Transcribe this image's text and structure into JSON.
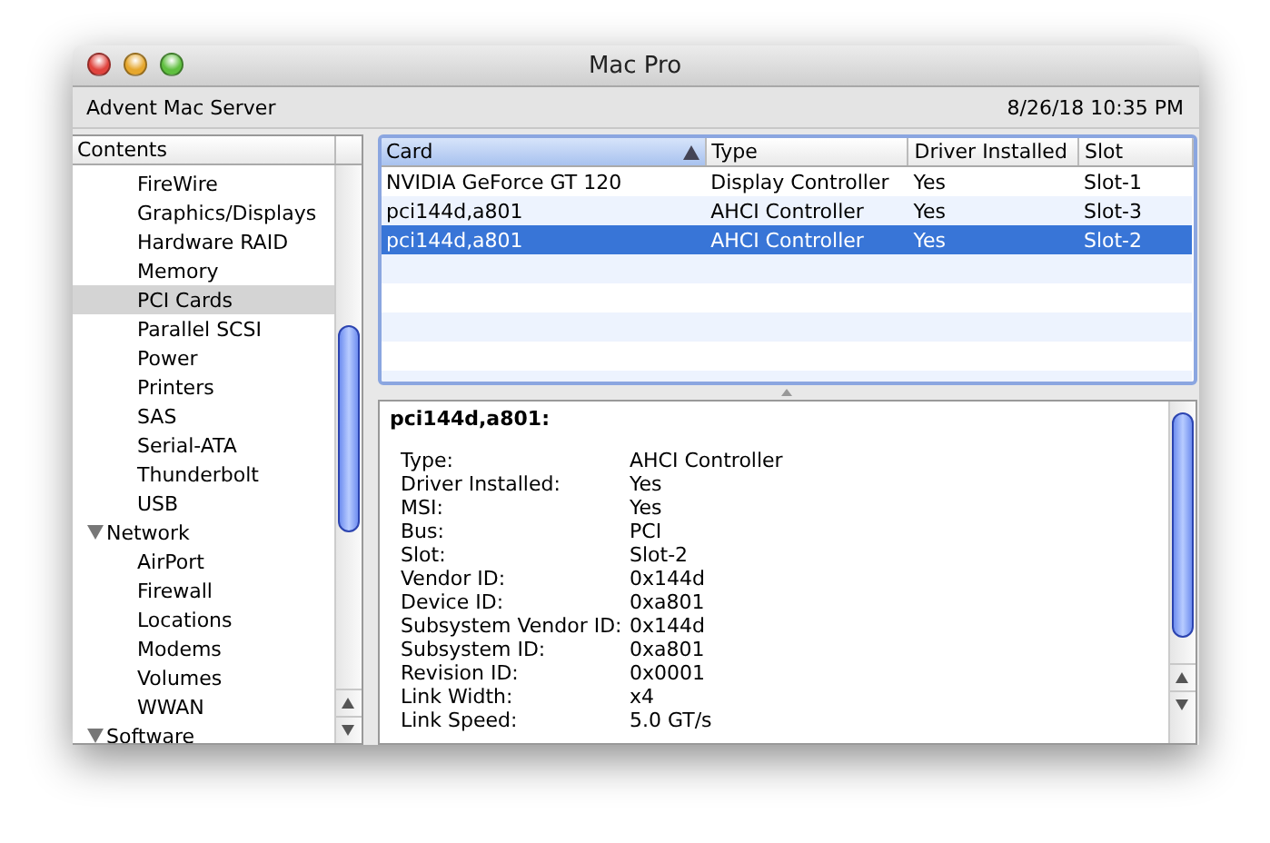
{
  "window": {
    "title": "Mac Pro"
  },
  "toolbar": {
    "computer_name": "Advent Mac Server",
    "date_time": "8/26/18 10:35 PM"
  },
  "sidebar": {
    "header": "Contents",
    "items": [
      {
        "kind": "leaf",
        "label": "FireWire",
        "selected": false
      },
      {
        "kind": "leaf",
        "label": "Graphics/Displays",
        "selected": false
      },
      {
        "kind": "leaf",
        "label": "Hardware RAID",
        "selected": false
      },
      {
        "kind": "leaf",
        "label": "Memory",
        "selected": false
      },
      {
        "kind": "leaf",
        "label": "PCI Cards",
        "selected": true
      },
      {
        "kind": "leaf",
        "label": "Parallel SCSI",
        "selected": false
      },
      {
        "kind": "leaf",
        "label": "Power",
        "selected": false
      },
      {
        "kind": "leaf",
        "label": "Printers",
        "selected": false
      },
      {
        "kind": "leaf",
        "label": "SAS",
        "selected": false
      },
      {
        "kind": "leaf",
        "label": "Serial-ATA",
        "selected": false
      },
      {
        "kind": "leaf",
        "label": "Thunderbolt",
        "selected": false
      },
      {
        "kind": "leaf",
        "label": "USB",
        "selected": false
      },
      {
        "kind": "group",
        "label": "Network",
        "expanded": true,
        "selected": false,
        "children": [
          {
            "label": "AirPort",
            "selected": false
          },
          {
            "label": "Firewall",
            "selected": false
          },
          {
            "label": "Locations",
            "selected": false
          },
          {
            "label": "Modems",
            "selected": false
          },
          {
            "label": "Volumes",
            "selected": false
          },
          {
            "label": "WWAN",
            "selected": false
          }
        ]
      },
      {
        "kind": "group",
        "label": "Software",
        "expanded": true,
        "selected": false
      }
    ]
  },
  "table": {
    "columns": [
      "Card",
      "Type",
      "Driver Installed",
      "Slot"
    ],
    "rows": [
      {
        "cells": [
          "NVIDIA GeForce GT 120",
          "Display Controller",
          "Yes",
          "Slot-1"
        ],
        "selected": false
      },
      {
        "cells": [
          "pci144d,a801",
          "AHCI Controller",
          "Yes",
          "Slot-3"
        ],
        "selected": false
      },
      {
        "cells": [
          "pci144d,a801",
          "AHCI Controller",
          "Yes",
          "Slot-2"
        ],
        "selected": true
      }
    ]
  },
  "details": {
    "title": "pci144d,a801:",
    "fields": [
      {
        "label": "Type:",
        "value": "AHCI Controller"
      },
      {
        "label": "Driver Installed:",
        "value": "Yes"
      },
      {
        "label": "MSI:",
        "value": "Yes"
      },
      {
        "label": "Bus:",
        "value": "PCI"
      },
      {
        "label": "Slot:",
        "value": "Slot-2"
      },
      {
        "label": "Vendor ID:",
        "value": "0x144d"
      },
      {
        "label": "Device ID:",
        "value": "0xa801"
      },
      {
        "label": "Subsystem Vendor ID:",
        "value": "0x144d"
      },
      {
        "label": "Subsystem ID:",
        "value": "0xa801"
      },
      {
        "label": "Revision ID:",
        "value": "0x0001"
      },
      {
        "label": "Link Width:",
        "value": "x4"
      },
      {
        "label": "Link Speed:",
        "value": "5.0 GT/s"
      }
    ]
  }
}
